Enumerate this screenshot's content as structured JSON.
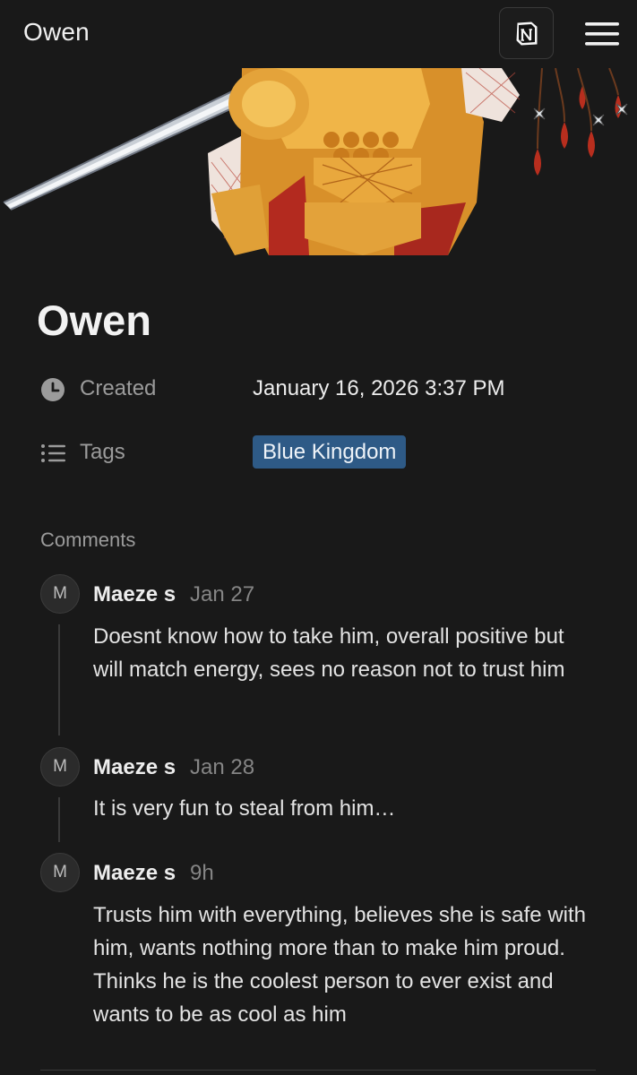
{
  "header": {
    "title": "Owen",
    "notion_icon": "notion-logo-icon",
    "menu_icon": "hamburger-menu-icon"
  },
  "cover": {
    "description_icon": "armored-knight-cover-image"
  },
  "page": {
    "title": "Owen"
  },
  "properties": {
    "created": {
      "icon": "clock-icon",
      "label": "Created",
      "value": "January 16, 2026 3:37 PM"
    },
    "tags": {
      "icon": "list-icon",
      "label": "Tags",
      "value": "Blue Kingdom",
      "color": "#2e5a86"
    }
  },
  "comments": {
    "heading": "Comments",
    "items": [
      {
        "avatar": "M",
        "author": "Maeze s",
        "date": "Jan 27",
        "text": "Doesnt know how to take him, overall positive but will match energy, sees no reason not to trust him"
      },
      {
        "avatar": "M",
        "author": "Maeze s",
        "date": "Jan 28",
        "text": "It is very fun to steal from him…"
      },
      {
        "avatar": "M",
        "author": "Maeze s",
        "date": "9h",
        "text": "Trusts him with everything, believes she is safe with him, wants nothing more than to make him proud. Thinks he is the coolest person to ever exist and wants to be as cool as him"
      }
    ]
  },
  "colors": {
    "background": "#191919",
    "tag_blue": "#2e5a86",
    "muted_text": "#9b9b9b"
  }
}
